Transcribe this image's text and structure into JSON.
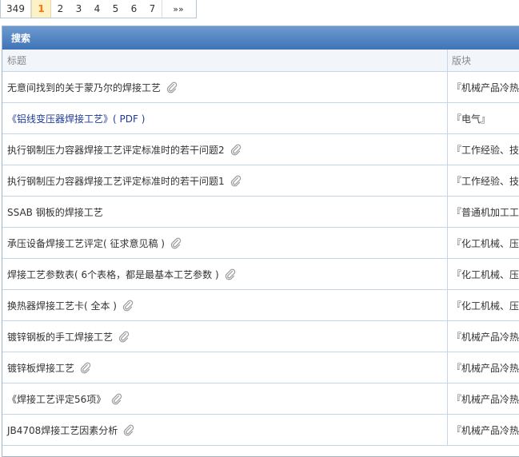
{
  "pager": {
    "total": "349",
    "pages": [
      "1",
      "2",
      "3",
      "4",
      "5",
      "6",
      "7"
    ],
    "current": "1",
    "next": "»»"
  },
  "panel": {
    "title": "搜索",
    "col_title": "标题",
    "col_board": "版块"
  },
  "rows": [
    {
      "title": "无意间找到的关于蒙乃尔的焊接工艺",
      "board": "『机械产品冷热",
      "attach": true,
      "blue": false
    },
    {
      "title": "《铝线变压器焊接工艺》( PDF )",
      "board": "『电气』",
      "attach": false,
      "blue": true
    },
    {
      "title": "执行钢制压力容器焊接工艺评定标准时的若干问题2",
      "board": "『工作经验、技",
      "attach": true,
      "blue": false
    },
    {
      "title": "执行钢制压力容器焊接工艺评定标准时的若干问题1",
      "board": "『工作经验、技",
      "attach": true,
      "blue": false
    },
    {
      "title": "SSAB 钢板的焊接工艺",
      "board": "『普通机加工工",
      "attach": false,
      "blue": false
    },
    {
      "title": "承压设备焊接工艺评定( 征求意见稿 )",
      "board": "『化工机械、压",
      "attach": true,
      "blue": false
    },
    {
      "title": "焊接工艺参数表( 6个表格，都是最基本工艺参数 )",
      "board": "『化工机械、压",
      "attach": true,
      "blue": false
    },
    {
      "title": "换热器焊接工艺卡( 全本 )",
      "board": "『化工机械、压",
      "attach": true,
      "blue": false
    },
    {
      "title": "镀锌钢板的手工焊接工艺",
      "board": "『机械产品冷热",
      "attach": true,
      "blue": false
    },
    {
      "title": "镀锌板焊接工艺",
      "board": "『机械产品冷热",
      "attach": true,
      "blue": false
    },
    {
      "title": "《焊接工艺评定56项》",
      "board": "『机械产品冷热",
      "attach": true,
      "blue": false
    },
    {
      "title": "JB4708焊接工艺因素分析",
      "board": "『机械产品冷热",
      "attach": true,
      "blue": false
    }
  ],
  "icons": {
    "attachment": "paperclip-icon"
  }
}
